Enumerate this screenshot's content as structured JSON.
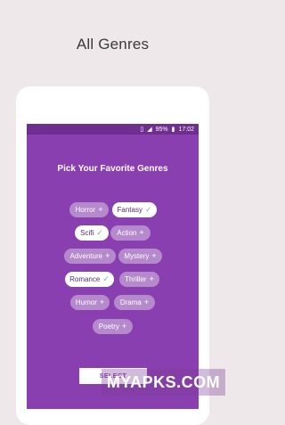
{
  "headline": "All Genres",
  "status": {
    "battery": "95%",
    "time": "17:02",
    "icons": [
      "vibrate-icon",
      "signal-icon",
      "battery-icon"
    ]
  },
  "screen": {
    "title": "Pick Your Favorite Genres",
    "genres": [
      {
        "label": "Horror",
        "selected": false,
        "mark": "+"
      },
      {
        "label": "Fantasy",
        "selected": true,
        "mark": "✓"
      },
      {
        "label": "Scifi",
        "selected": true,
        "mark": "✓"
      },
      {
        "label": "Action",
        "selected": false,
        "mark": "+"
      },
      {
        "label": "Adventure",
        "selected": false,
        "mark": "+"
      },
      {
        "label": "Mystery",
        "selected": false,
        "mark": "+"
      },
      {
        "label": "Romance",
        "selected": true,
        "mark": "✓"
      },
      {
        "label": "Thriller",
        "selected": false,
        "mark": "+"
      },
      {
        "label": "Humor",
        "selected": false,
        "mark": "+"
      },
      {
        "label": "Drama",
        "selected": false,
        "mark": "+"
      },
      {
        "label": "Poetry",
        "selected": false,
        "mark": "+"
      }
    ],
    "select_button": "SELECT"
  },
  "watermark": "MYAPKS.COM",
  "colors": {
    "background": "#efe8ea",
    "screen": "#8a3fb0",
    "chip": "#b58acd",
    "chip_selected": "#ffffff",
    "check": "#6fbf8a"
  }
}
